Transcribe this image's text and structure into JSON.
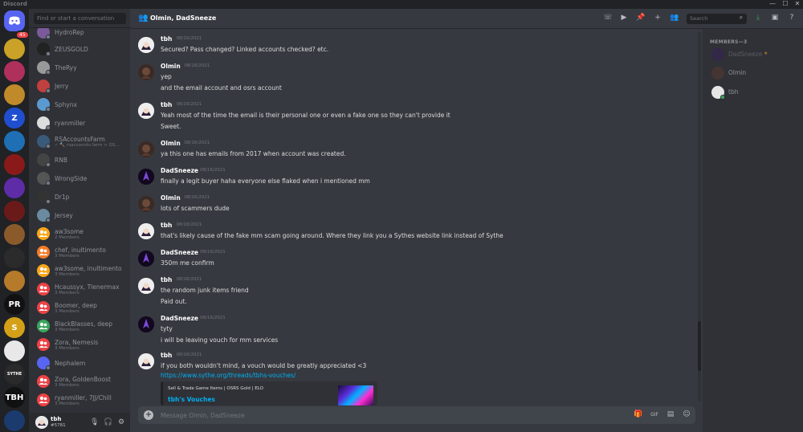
{
  "window": {
    "title": "Discord",
    "controls": [
      "—",
      "☐",
      "✕"
    ]
  },
  "servers": {
    "home_mention_count": "45",
    "list": [
      {
        "label": "Discord",
        "color": "#5865f2"
      },
      {
        "label": "",
        "color": "#c9a227"
      },
      {
        "label": "",
        "color": "#b0305c"
      },
      {
        "label": "",
        "color": "#c08a2a"
      },
      {
        "label": "Z",
        "color": "#1f4fd0"
      },
      {
        "label": "",
        "color": "#1f6fb5"
      },
      {
        "label": "",
        "color": "#8a1a1a"
      },
      {
        "label": "",
        "color": "#5d2ca6"
      },
      {
        "label": "",
        "color": "#6b1a1a"
      },
      {
        "label": "",
        "color": "#8b5a2b"
      },
      {
        "label": "",
        "color": "#2b2b2b"
      },
      {
        "label": "",
        "color": "#b57a2a"
      },
      {
        "label": "PR",
        "color": "#111111"
      },
      {
        "label": "S",
        "color": "#d4a017"
      },
      {
        "label": "",
        "color": "#e8e8e8"
      },
      {
        "label": "SYTHE",
        "color": "#2a2a2a"
      },
      {
        "label": "TBH",
        "color": "#111111"
      },
      {
        "label": "",
        "color": "#1b3b6f"
      }
    ]
  },
  "dm_search": {
    "placeholder": "Find or start a conversation"
  },
  "dms": [
    {
      "name": "HydroRep",
      "sub": "",
      "color": "#7a5a9a"
    },
    {
      "name": "ZEUSGOLD",
      "sub": "",
      "color": "#222222"
    },
    {
      "name": "TheRyy",
      "sub": "",
      "color": "#999999"
    },
    {
      "name": "Jerry",
      "sub": "",
      "color": "#c04040"
    },
    {
      "name": "Sphynx",
      "sub": "",
      "color": "#5a9ad0"
    },
    {
      "name": "ryanmiller",
      "sub": "",
      "color": "#dddddd"
    },
    {
      "name": "RSAccountsFarm",
      "sub": "✓ 🔨 rsaccounts.farm > OS...",
      "color": "#3a5a7a"
    },
    {
      "name": "RNB",
      "sub": "",
      "color": "#444444"
    },
    {
      "name": "WrongSide",
      "sub": "",
      "color": "#555555"
    },
    {
      "name": "Dr1p",
      "sub": "",
      "color": "#333333"
    },
    {
      "name": "Jersey",
      "sub": "",
      "color": "#6a8aa0"
    },
    {
      "name": "aw3some",
      "sub": "2 Members",
      "color": "#faa61a"
    },
    {
      "name": "chef, inultimento",
      "sub": "3 Members",
      "color": "#f47b28"
    },
    {
      "name": "aw3some, inultimento",
      "sub": "3 Members",
      "color": "#faa61a"
    },
    {
      "name": "Hcaussyx, Tlenermax",
      "sub": "3 Members",
      "color": "#ed4245"
    },
    {
      "name": "Boomer, deep",
      "sub": "3 Members",
      "color": "#ed4245"
    },
    {
      "name": "BlackBlasses, deep",
      "sub": "3 Members",
      "color": "#3ba55d"
    },
    {
      "name": "Zora, Nemesis",
      "sub": "3 Members",
      "color": "#ed4245"
    },
    {
      "name": "Nephalem",
      "sub": "",
      "color": "#5865f2"
    },
    {
      "name": "Zora, GoldenBoost",
      "sub": "3 Members",
      "color": "#ed4245"
    },
    {
      "name": "ryanmiller, 7JJ/Chill",
      "sub": "3 Members",
      "color": "#ed4245"
    }
  ],
  "user_panel": {
    "name": "tbh",
    "tag": "#5781"
  },
  "header": {
    "title": "Olmin, DadSneeze",
    "search_placeholder": "Search"
  },
  "messages": [
    {
      "author": "tbh",
      "time": "08/16/2021",
      "lines": [
        "Secured? Pass changed? Linked accounts checked? etc."
      ]
    },
    {
      "author": "Olmin",
      "time": "08/16/2021",
      "lines": [
        "yep",
        "and the email account and osrs account"
      ]
    },
    {
      "author": "tbh",
      "time": "08/16/2021",
      "lines": [
        "Yeah most of the time the email is their personal one or even a fake one so they can't provide it",
        "Sweet."
      ]
    },
    {
      "author": "Olmin",
      "time": "08/16/2021",
      "lines": [
        "ya this one has emails from 2017 when account was created."
      ]
    },
    {
      "author": "DadSneeze",
      "time": "08/16/2021",
      "lines": [
        "finally a legit buyer haha everyone else flaked when i mentioned mm"
      ]
    },
    {
      "author": "Olmin",
      "time": "08/16/2021",
      "lines": [
        "lots of scammers dude"
      ]
    },
    {
      "author": "tbh",
      "time": "08/16/2021",
      "lines": [
        "that's likely cause of the fake mm scam going around. Where they link you a Sythes website link instead of Sythe"
      ]
    },
    {
      "author": "DadSneeze",
      "time": "08/16/2021",
      "lines": [
        "350m me confirm"
      ]
    },
    {
      "author": "tbh",
      "time": "08/16/2021",
      "lines": [
        "the random junk items friend",
        "Paid out."
      ]
    },
    {
      "author": "DadSneeze",
      "time": "08/16/2021",
      "lines": [
        "tyty",
        "i will be leaving vouch for mm services"
      ]
    },
    {
      "author": "tbh",
      "time": "08/16/2021",
      "lines": [
        "if you both wouldn't mind, a vouch would be greatly appreciated <3"
      ],
      "link": "https://www.sythe.org/threads/tbhs-vouches/"
    }
  ],
  "embed": {
    "provider": "Sell & Trade Game Items | OSRS Gold | ELO",
    "title": "tbh's Vouches"
  },
  "composer": {
    "placeholder": "Message Olmin, DadSneeze"
  },
  "members": {
    "header": "MEMBERS—3",
    "list": [
      {
        "name": "DadSneeze",
        "owner_icon": "★",
        "status": "offline"
      },
      {
        "name": "Olmin",
        "status": "offline"
      },
      {
        "name": "tbh",
        "status": "online"
      }
    ]
  },
  "colors": {
    "accent": "#5865f2",
    "link": "#00aff4",
    "online": "#3ba55d",
    "mention": "#ed4245"
  }
}
